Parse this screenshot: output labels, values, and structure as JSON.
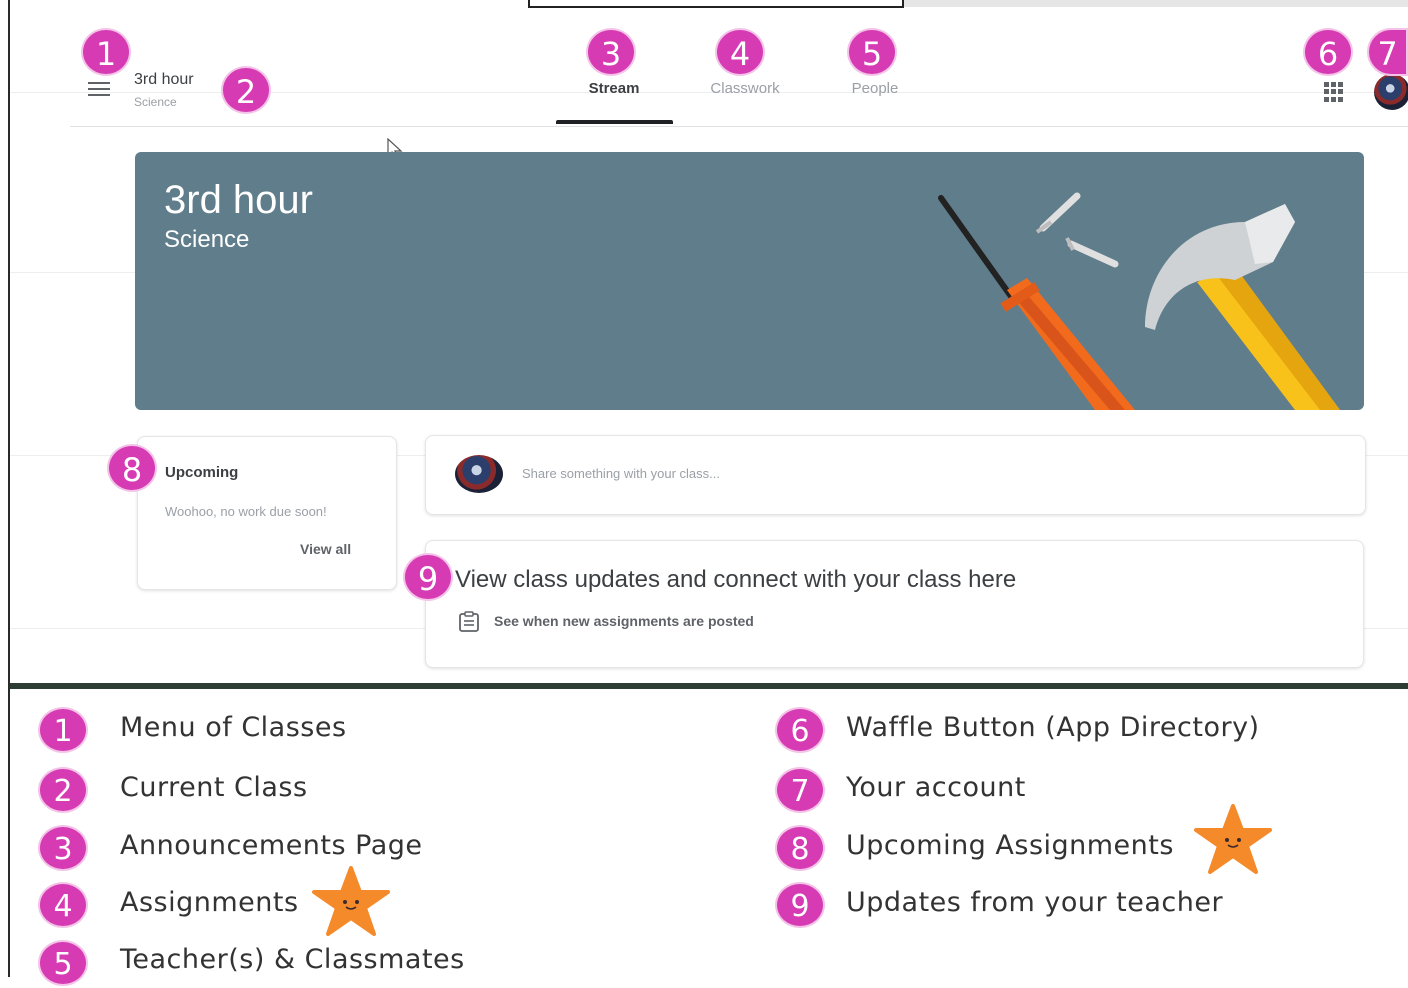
{
  "header": {
    "class_title": "3rd hour",
    "class_subtitle": "Science",
    "tabs": [
      {
        "label": "Stream",
        "active": true
      },
      {
        "label": "Classwork",
        "active": false
      },
      {
        "label": "People",
        "active": false
      }
    ]
  },
  "banner": {
    "title": "3rd hour",
    "subtitle": "Science"
  },
  "upcoming": {
    "title": "Upcoming",
    "message": "Woohoo, no work due soon!",
    "link": "View all"
  },
  "share": {
    "placeholder": "Share something with your class..."
  },
  "updates": {
    "title": "View class updates and connect with your class here",
    "subtitle": "See when new assignments are posted"
  },
  "badges": [
    "1",
    "2",
    "3",
    "4",
    "5",
    "6",
    "7",
    "8",
    "9"
  ],
  "legend": [
    {
      "number": "1",
      "text": "Menu of Classes"
    },
    {
      "number": "2",
      "text": "Current Class"
    },
    {
      "number": "3",
      "text": "Announcements Page"
    },
    {
      "number": "4",
      "text": "Assignments"
    },
    {
      "number": "5",
      "text": "Teacher(s) & Classmates"
    },
    {
      "number": "6",
      "text": "Waffle Button (App Directory)"
    },
    {
      "number": "7",
      "text": "Your account"
    },
    {
      "number": "8",
      "text": "Upcoming Assignments"
    },
    {
      "number": "9",
      "text": "Updates from your teacher"
    }
  ],
  "colors": {
    "badge": "#d63bb3",
    "banner": "#607d8b",
    "star": "#f58a2a"
  },
  "icons": [
    "menu-icon",
    "waffle-icon",
    "avatar-icon",
    "assignment-icon",
    "star-icon",
    "cursor-icon"
  ]
}
